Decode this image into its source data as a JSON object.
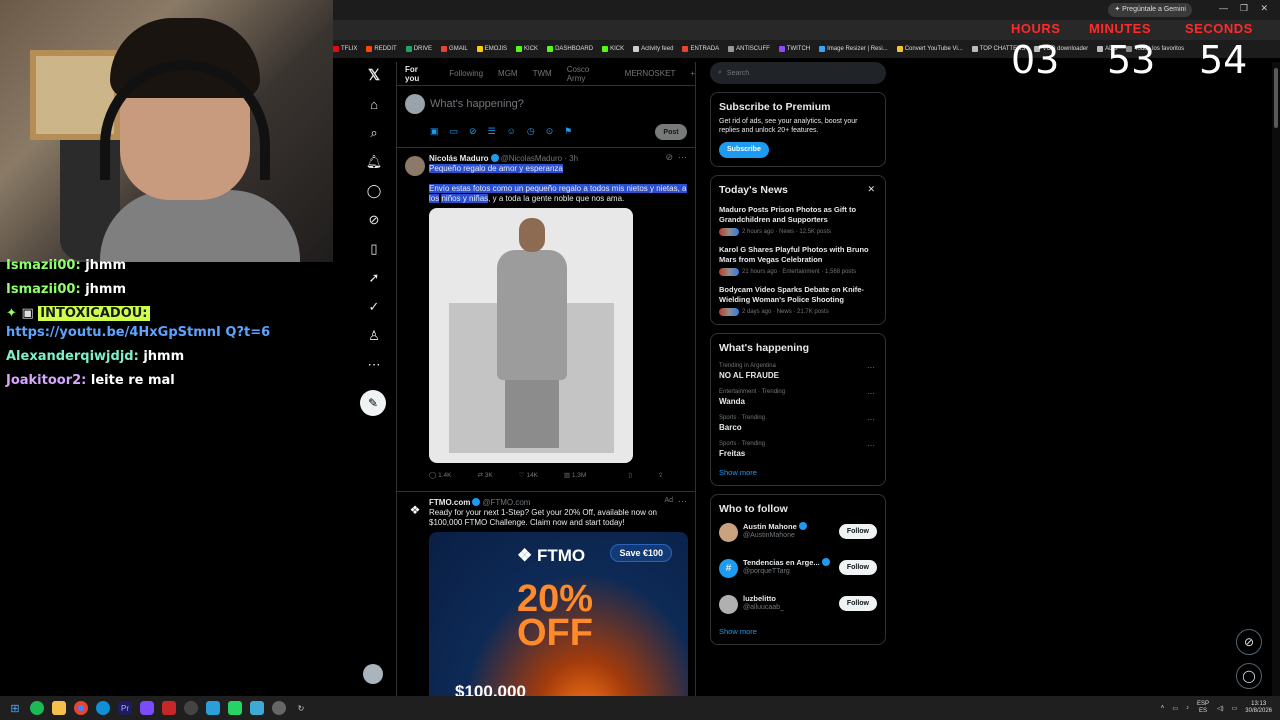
{
  "chat": {
    "messages": [
      {
        "user": "Ismazii00:",
        "text": "jhmm",
        "cls": "u-green"
      },
      {
        "user": "Ismazii00:",
        "text": "jhmm",
        "cls": "u-green"
      },
      {
        "user": "INTOXICADOU:",
        "text": "https://youtu.be/4HxGpStmnI Q?t=6",
        "cls": "u-badge"
      },
      {
        "user": "Alexanderqiwjdjd:",
        "text": "jhmm",
        "cls": "u-teal"
      },
      {
        "user": "Joakitoor2:",
        "text": "leite re mal",
        "cls": "u-purple"
      }
    ]
  },
  "browser": {
    "gemini": "Pregúntale a Gemini",
    "bookmarks": [
      {
        "label": "TFLIX",
        "color": "#e50914"
      },
      {
        "label": "REDDIT",
        "color": "#ff4500"
      },
      {
        "label": "DRIVE",
        "color": "#1fa463"
      },
      {
        "label": "GMAIL",
        "color": "#ea4335"
      },
      {
        "label": "EMOJIS",
        "color": "#ffcc00"
      },
      {
        "label": "KICK",
        "color": "#53fc18"
      },
      {
        "label": "DASHBOARD",
        "color": "#53fc18"
      },
      {
        "label": "KICK",
        "color": "#53fc18"
      },
      {
        "label": "Activity feed",
        "color": "#cccccc"
      },
      {
        "label": "ENTRADA",
        "color": "#ea4335"
      },
      {
        "label": "ANTISCUFF",
        "color": "#999999"
      },
      {
        "label": "TWITCH",
        "color": "#9146ff"
      },
      {
        "label": "Image Resizer | Resi...",
        "color": "#3ba4f5"
      },
      {
        "label": "Convert YouTube Vi...",
        "color": "#f4c430"
      },
      {
        "label": "TOP CHATTERS",
        "color": "#bbbbbb"
      },
      {
        "label": "VOD downloader",
        "color": "#bbbbbb"
      },
      {
        "label": "ADS",
        "color": "#bbbbbb"
      },
      {
        "label": "Todos los favoritos",
        "color": "#888888"
      }
    ]
  },
  "countdown": {
    "hours_label": "HOURS",
    "minutes_label": "MINUTES",
    "seconds_label": "SECONDS",
    "hours": "03",
    "minutes": "53",
    "seconds": "54"
  },
  "timeline": {
    "tabs": [
      "For you",
      "Following",
      "MGM",
      "TWM",
      "Cosco Army",
      "MERNOSKET"
    ],
    "composer_placeholder": "What's happening?",
    "post_label": "Post",
    "tweet1": {
      "name": "Nicolás Maduro",
      "handle": "@NicolasMaduro · 3h",
      "line1": "Pequeño regalo de amor y esperanza",
      "line2a": "Envío estas fotos como un pequeño regalo a todos mis nietos y nietas, a los",
      "line2b": "niños y niñas",
      "line2c": ", y a toda la gente noble que nos ama.",
      "replies": "1.4K",
      "reposts": "3K",
      "likes": "14K",
      "views": "1.3M"
    },
    "tweet2": {
      "name": "FTMO.com",
      "handle": "@FTMO.com",
      "ad_label": "Ad",
      "text": "Ready for your next 1-Step? Get your 20% Off, available now on $100,000 FTMO Challenge. Claim now and start today!",
      "logo": "FTMO",
      "save": "Save €100",
      "pct": "20%",
      "off": "OFF",
      "bottom": "$100,000"
    }
  },
  "sidebar": {
    "search_placeholder": "Search",
    "premium": {
      "title": "Subscribe to Premium",
      "text": "Get rid of ads, see your analytics, boost your replies and unlock 20+ features.",
      "button": "Subscribe"
    },
    "news": {
      "title": "Today's News",
      "items": [
        {
          "title": "Maduro Posts Prison Photos as Gift to Grandchildren and Supporters",
          "meta": "2 hours ago · News · 12.5K posts"
        },
        {
          "title": "Karol G Shares Playful Photos with Bruno Mars from Vegas Celebration",
          "meta": "21 hours ago · Entertainment · 1,568 posts"
        },
        {
          "title": "Bodycam Video Sparks Debate on Knife-Wielding Woman's Police Shooting",
          "meta": "2 days ago · News · 21.7K posts"
        }
      ]
    },
    "happening": {
      "title": "What's happening",
      "trends": [
        {
          "ctx": "Trending in Argentina",
          "name": "NO AL FRAUDE"
        },
        {
          "ctx": "Entertainment · Trending",
          "name": "Wanda"
        },
        {
          "ctx": "Sports · Trending",
          "name": "Barco"
        },
        {
          "ctx": "Sports · Trending",
          "name": "Freitas"
        }
      ],
      "show_more": "Show more"
    },
    "who": {
      "title": "Who to follow",
      "people": [
        {
          "name": "Austin Mahone",
          "handle": "@AustinMahone",
          "color": "#c9a27e"
        },
        {
          "name": "Tendencias en Arge...",
          "handle": "@porqueTTarg",
          "color": "#1d9bf0"
        },
        {
          "name": "luzbelitto",
          "handle": "@alluucaab_",
          "color": "#b0b0b0"
        }
      ],
      "follow": "Follow",
      "show_more": "Show more"
    }
  },
  "taskbar": {
    "lang": "ESP",
    "lang2": "ES",
    "time": "13:13",
    "date": "30/8/2026"
  }
}
